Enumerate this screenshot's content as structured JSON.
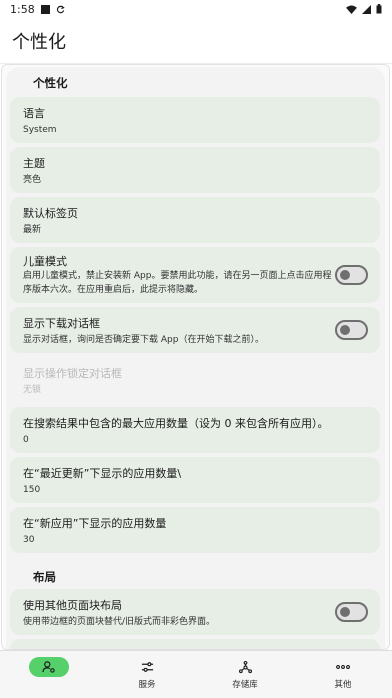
{
  "status_bar": {
    "time": "1:58"
  },
  "app_bar": {
    "title": "个性化"
  },
  "sections": {
    "personalize": "个性化",
    "layout": "布局"
  },
  "items": {
    "language": {
      "title": "语言",
      "value": "System"
    },
    "theme": {
      "title": "主题",
      "value": "亮色"
    },
    "default_tab": {
      "title": "默认标签页",
      "value": "最新"
    },
    "kids_mode": {
      "title": "儿童模式",
      "desc": "启用儿童模式，禁止安装新 App。要禁用此功能，请在另一页面上点击应用程序版本六次。在应用重启后，此提示将隐藏。",
      "on": false
    },
    "download_dialog": {
      "title": "显示下载对话框",
      "desc": "显示对话框，询问是否确定要下载 App（在开始下载之前）。",
      "on": false
    },
    "lock_dialog": {
      "title": "显示操作锁定对话框",
      "value": "无锁"
    },
    "max_results": {
      "title": "在搜索结果中包含的最大应用数量（设为 0 来包含所有应用）。",
      "value": "0"
    },
    "recent_updates": {
      "title": "在“最近更新”下显示的应用数量\\",
      "value": "150"
    },
    "new_apps": {
      "title": "在“新应用”下显示的应用数量",
      "value": "30"
    },
    "alt_layout": {
      "title": "使用其他页面块布局",
      "desc": "使用带边框的页面块替代/旧版式而非彩色界面。",
      "on": false
    }
  },
  "bottom_nav": {
    "items": [
      {
        "label": "",
        "icon": "person-settings-icon",
        "active": true
      },
      {
        "label": "服务",
        "icon": "sliders-icon",
        "active": false
      },
      {
        "label": "存储库",
        "icon": "hub-icon",
        "active": false
      },
      {
        "label": "其他",
        "icon": "more-icon",
        "active": false
      }
    ]
  },
  "colors": {
    "item_bg": "#e6eee5",
    "active_pill": "#56d06a"
  }
}
